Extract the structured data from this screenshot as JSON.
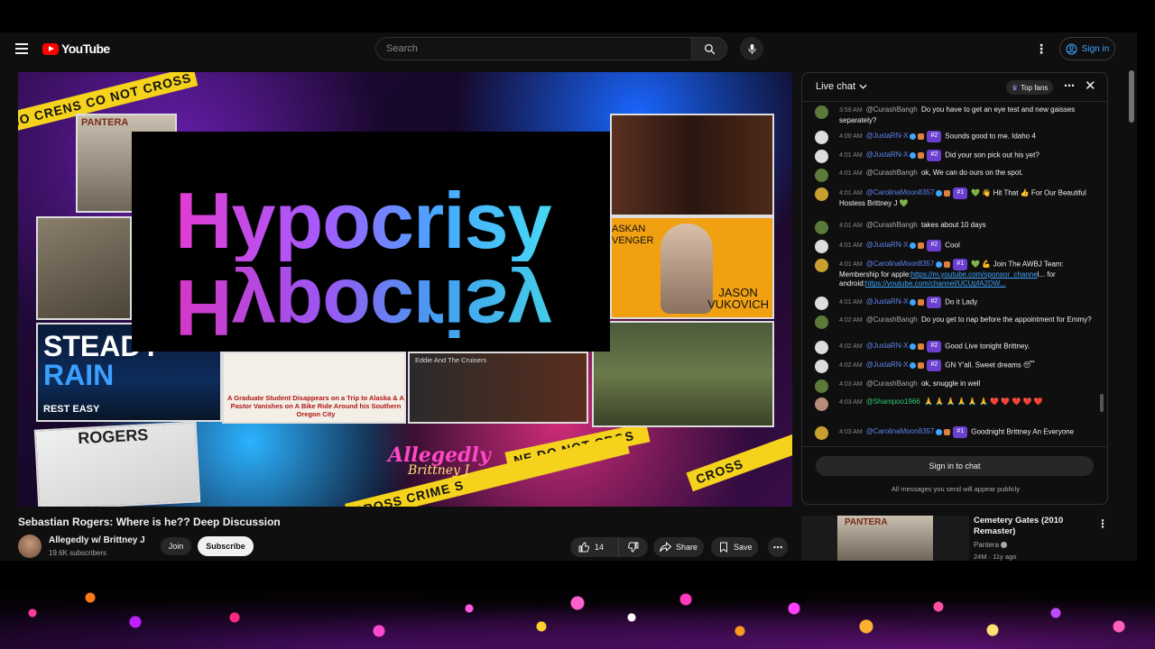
{
  "header": {
    "logo_text": "YouTube",
    "search_placeholder": "Search",
    "signin_label": "Sign in"
  },
  "player": {
    "overlay_word": "Hypocrisy",
    "pantera_label": "PANTERA",
    "steady_line1": "STEADY",
    "steady_line2": "RAIN",
    "steady_sub": "REST EASY",
    "jason_line1": "JASON",
    "jason_line2": "VUKOVICH",
    "avenger_line1": "ASKAN",
    "avenger_line2": "VENGER",
    "grad_caption": "A Graduate Student Disappears on a Trip to Alaska & A Pastor Vanishes on A Bike Ride Around his Southern Oregon City",
    "eddie_caption": "Eddie And The Cruisers",
    "rogers_label": "ROGERS",
    "allegedly_title": "Allegedly",
    "allegedly_sub": "Brittney J",
    "tape1": "NO CRENS CO NOT CROSS",
    "tape2": "CROSS CRIME S",
    "tape3": "CROSS",
    "tape4": "NE DO NOT CROS"
  },
  "video": {
    "title": "Sebastian Rogers: Where is he?? Deep Discussion",
    "channel": "Allegedly w/ Brittney J",
    "subscribers": "19.6K subscribers",
    "join_label": "Join",
    "subscribe_label": "Subscribe",
    "like_count": "14",
    "share_label": "Share",
    "save_label": "Save"
  },
  "chat": {
    "title": "Live chat",
    "top_fans_label": "Top fans",
    "signin_label": "Sign in to chat",
    "public_note": "All messages you send will appear publicly",
    "messages": [
      {
        "time": "3:59 AM",
        "author": "@CurashBangh",
        "text": "Do you have to get an eye test and new gaisses separately?"
      },
      {
        "time": "4:00 AM",
        "author": "@JustaRN-X",
        "rank": "#2",
        "text": "Sounds good to me. Idaho 4"
      },
      {
        "time": "4:01 AM",
        "author": "@JustaRN-X",
        "rank": "#2",
        "text": "Did your son pick out his yet?"
      },
      {
        "time": "4:01 AM",
        "author": "@CurashBangh",
        "text": "ok, We can do ours on the spot."
      },
      {
        "time": "4:01 AM",
        "author": "@CarolinaMoon8357",
        "rank": "#1",
        "text": "💚 👋 Hit That 👍 For Our Beautiful Hostess Brittney J 💚"
      },
      {
        "time": "4:01 AM",
        "author": "@CurashBangh",
        "text": "takes about 10 days"
      },
      {
        "time": "4:01 AM",
        "author": "@JustaRN-X",
        "rank": "#2",
        "text": "Cool"
      },
      {
        "time": "4:01 AM",
        "author": "@CarolinaMoon8357",
        "rank": "#1",
        "text": "💚 💪 Join The AWBJ Team: Membership for apple:",
        "link1": "https://m.youtube.com/sponsor_channe",
        "text2": "l... for android:",
        "link2": "https://youtube.com/channel/UCUpfA2DW..."
      },
      {
        "time": "4:01 AM",
        "author": "@JustaRN-X",
        "rank": "#2",
        "text": "Do it Lady"
      },
      {
        "time": "4:02 AM",
        "author": "@CurashBangh",
        "text": "Do you get to nap before the appointment for Emmy?"
      },
      {
        "time": "4:02 AM",
        "author": "@JustaRN-X",
        "rank": "#2",
        "text": "Good Live tonight Brittney."
      },
      {
        "time": "4:02 AM",
        "author": "@JustaRN-X",
        "rank": "#2",
        "text": "GN Y'all. Sweet dreams 😴"
      },
      {
        "time": "4:03 AM",
        "author": "@CurashBangh",
        "text": "ok, snuggle in well"
      },
      {
        "time": "4:03 AM",
        "author": "@Shampoo1966",
        "text": "🙏 🙏 🙏 🙏 🙏 🙏 ❤️ ❤️ ❤️ ❤️ ❤️"
      },
      {
        "time": "4:03 AM",
        "author": "@CarolinaMoon8357",
        "rank": "#1",
        "text": "Goodnight Brittney An Everyone"
      }
    ]
  },
  "recommended": {
    "title": "Cemetery Gates (2010 Remaster)",
    "channel": "Pantera",
    "meta": "24M · 11y ago",
    "thumb_label": "PANTERA"
  },
  "colors": {
    "brand": "#ff0000",
    "link": "#3ea6ff",
    "rank_badge": "#6b3fd0",
    "background": "#0f0f0f"
  }
}
